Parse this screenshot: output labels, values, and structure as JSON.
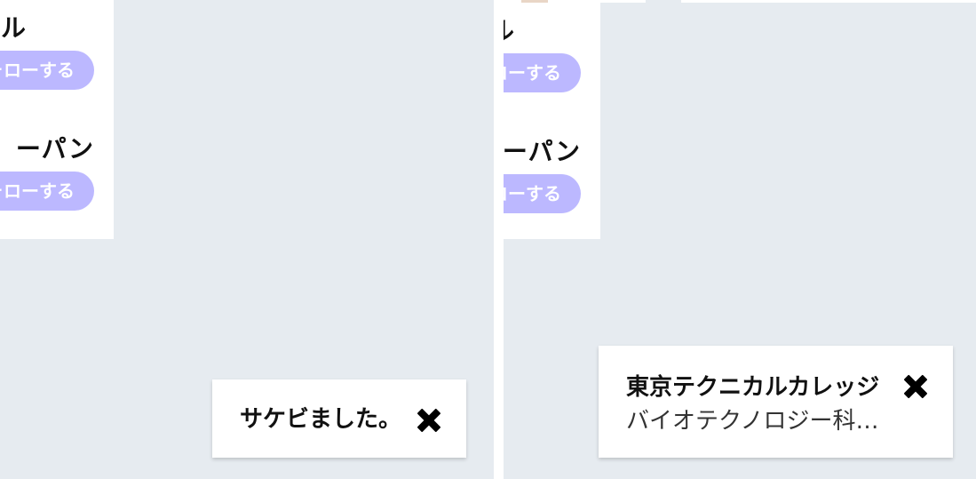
{
  "left_pane": {
    "suggestions": [
      {
        "name": "ル",
        "follow_label": "フォローする"
      },
      {
        "name": "ーパン",
        "follow_label": "フォローする"
      }
    ],
    "toast": {
      "title": "サケビました。"
    }
  },
  "right_pane": {
    "suggestions": [
      {
        "name": "ル",
        "follow_label": "フォローする"
      },
      {
        "name": "ーパン",
        "follow_label": "フォローする"
      }
    ],
    "toast": {
      "title": "東京テクニカルカレッジ",
      "subtitle": "バイオテクノロジー科…"
    }
  },
  "colors": {
    "background": "#e6ebf0",
    "follow_button": "#bcb8ff",
    "card": "#ffffff"
  }
}
